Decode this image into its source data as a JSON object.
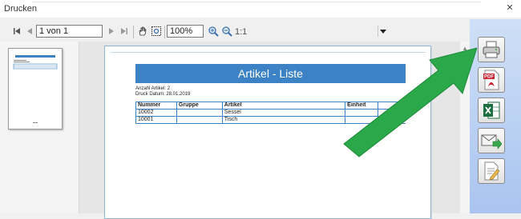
{
  "window": {
    "title": "Drucken"
  },
  "toolbar": {
    "page_combo_value": "1 von 1",
    "zoom_combo_value": "100%",
    "one_to_one_label": "1:1"
  },
  "report": {
    "title": "Artikel - Liste",
    "count_line": "Anzahl Artikel: 2",
    "date_line": "Druck Datum: 28.01.2019",
    "columns": [
      "Nummer",
      "Gruppe",
      "Artikel",
      "Einheit",
      "Pre"
    ],
    "rows": [
      [
        "10002",
        "",
        "Sessel",
        "",
        ""
      ],
      [
        "10001",
        "",
        "Tisch",
        "",
        ""
      ]
    ]
  },
  "sidebar": {
    "pdf_badge": "PDF"
  },
  "colors": {
    "report_header": "#3c82c4",
    "annotation_arrow": "#2aa84a"
  }
}
